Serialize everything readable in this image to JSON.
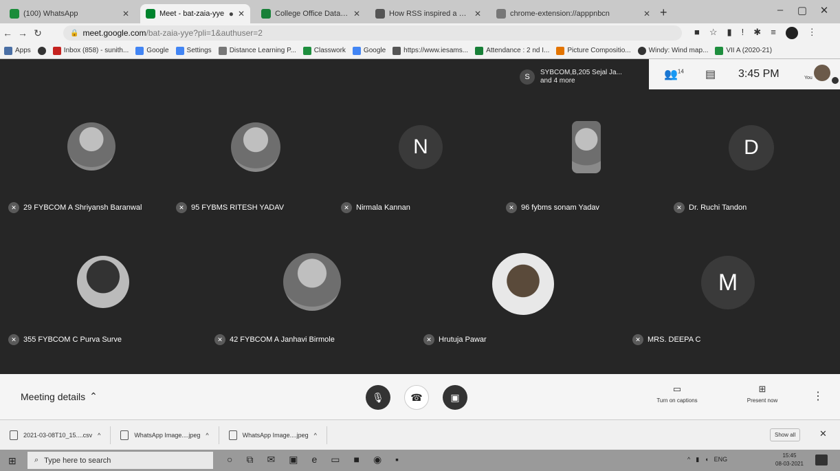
{
  "browser": {
    "tabs": [
      {
        "label": "(100) WhatsApp",
        "active": false,
        "color": "#1a8c3a"
      },
      {
        "label": "Meet - bat-zaia-yye",
        "active": true,
        "color": "#00832d"
      },
      {
        "label": "College Office Data for NAAC - ",
        "active": false,
        "color": "#188038"
      },
      {
        "label": "How RSS inspired a young wido",
        "active": false,
        "color": "#555555"
      },
      {
        "label": "chrome-extension://apppnbcn",
        "active": false,
        "color": "#777777"
      }
    ],
    "url_host": "meet.google.com",
    "url_rest": "/bat-zaia-yye?pli=1&authuser=2",
    "bookmarks": [
      {
        "label": "Apps",
        "icon": "apps-grid-icon"
      },
      {
        "label": "",
        "icon": "chrome-icon"
      },
      {
        "label": "Inbox (858) - sunith...",
        "icon": "gmail-icon"
      },
      {
        "label": "Google",
        "icon": "google-icon"
      },
      {
        "label": "Settings",
        "icon": "google-icon"
      },
      {
        "label": "Distance Learning P...",
        "icon": "bookmark-icon"
      },
      {
        "label": "Classwork",
        "icon": "classroom-icon"
      },
      {
        "label": "Google",
        "icon": "google-icon"
      },
      {
        "label": "https://www.iesams...",
        "icon": "site-icon"
      },
      {
        "label": "Attendance : 2 nd I...",
        "icon": "sheets-icon"
      },
      {
        "label": "Picture Compositio...",
        "icon": "picture-icon"
      },
      {
        "label": "Windy: Wind map...",
        "icon": "windy-icon"
      },
      {
        "label": "VII A (2020-21)",
        "icon": "classroom-icon"
      }
    ]
  },
  "meet": {
    "notification": {
      "initial": "S",
      "text_line1": "SYBCOM,B,205 Sejal Ja...",
      "text_line2": "and 4 more"
    },
    "participants_count": "14",
    "clock": "3:45 PM",
    "you_label": "You",
    "participants": [
      {
        "name": "29 FYBCOM A Shriyansh Baranwal",
        "avatar": "photo",
        "initial": ""
      },
      {
        "name": "95 FYBMS RITESH YADAV",
        "avatar": "photo",
        "initial": ""
      },
      {
        "name": "Nirmala Kannan",
        "avatar": "letter",
        "initial": "N"
      },
      {
        "name": "96 fybms sonam Yadav",
        "avatar": "photo-rect",
        "initial": ""
      },
      {
        "name": "Dr. Ruchi Tandon",
        "avatar": "letter",
        "initial": "D"
      },
      {
        "name": "355 FYBCOM C Purva Surve",
        "avatar": "photo",
        "initial": ""
      },
      {
        "name": "42 FYBCOM A Janhavi Birmole",
        "avatar": "photo",
        "initial": ""
      },
      {
        "name": "Hrutuja Pawar",
        "avatar": "photo-bright",
        "initial": ""
      },
      {
        "name": "MRS. DEEPA C",
        "avatar": "letter",
        "initial": "M"
      }
    ],
    "meeting_details": "Meeting details",
    "captions_label": "Turn on captions",
    "present_label": "Present now"
  },
  "downloads": [
    {
      "name": "2021-03-08T10_15....csv"
    },
    {
      "name": "WhatsApp Image....jpeg"
    },
    {
      "name": "WhatsApp Image....jpeg"
    }
  ],
  "downloads_show_all": "Show all",
  "taskbar": {
    "search_placeholder": "Type here to search",
    "language": "ENG",
    "time": "15:45",
    "date": "08-03-2021"
  }
}
